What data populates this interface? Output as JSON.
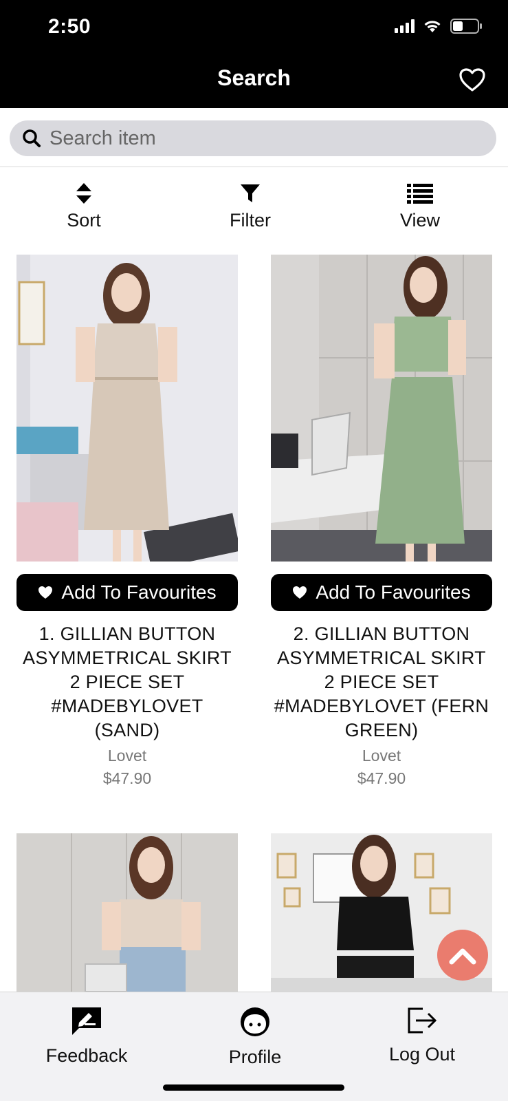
{
  "status_bar": {
    "time": "2:50"
  },
  "header": {
    "title": "Search"
  },
  "search": {
    "placeholder": "Search item"
  },
  "toolbar": {
    "sort_label": "Sort",
    "filter_label": "Filter",
    "view_label": "View"
  },
  "products": [
    {
      "fav_label": "Add To Favourites",
      "title": "1. GILLIAN BUTTON ASYMMETRICAL SKIRT 2 PIECE SET #MADEBYLOVET (SAND)",
      "brand": "Lovet",
      "price": "$47.90"
    },
    {
      "fav_label": "Add To Favourites",
      "title": "2. GILLIAN BUTTON ASYMMETRICAL SKIRT 2 PIECE SET #MADEBYLOVET (FERN GREEN)",
      "brand": "Lovet",
      "price": "$47.90"
    }
  ],
  "bottom_nav": {
    "feedback_label": "Feedback",
    "profile_label": "Profile",
    "logout_label": "Log Out"
  },
  "colors": {
    "accent": "#ea7c6e",
    "header_bg": "#000000",
    "search_bg": "#d9d9de",
    "nav_bg": "#f2f2f4"
  }
}
